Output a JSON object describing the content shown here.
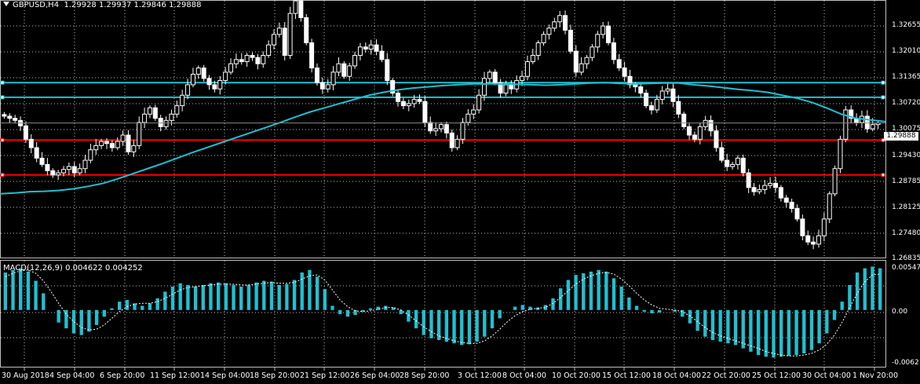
{
  "chart_header": {
    "symbol_timeframe": "GBPUSD,H4",
    "open": "1.29928",
    "high": "1.29937",
    "low": "1.29846",
    "close": "1.29888"
  },
  "price_axis": {
    "labels": [
      "1.32655",
      "1.32010",
      "1.31365",
      "1.30720",
      "1.30075",
      "1.29430",
      "1.28785",
      "1.28125",
      "1.27480",
      "1.26835"
    ],
    "current_price": "1.29888"
  },
  "macd_panel": {
    "title": "MACD(12,26,9) 0.004622 0.004252",
    "axis_labels": [
      "0.005478",
      "0.00",
      "-0.006217"
    ]
  },
  "time_axis": {
    "labels": [
      "30 Aug 2018",
      "4 Sep 04:00",
      "6 Sep 20:00",
      "11 Sep 12:00",
      "14 Sep 04:00",
      "18 Sep 20:00",
      "21 Sep 12:00",
      "26 Sep 04:00",
      "28 Sep 20:00",
      "3 Oct 12:00",
      "8 Oct 04:00",
      "10 Oct 20:00",
      "15 Oct 12:00",
      "18 Oct 04:00",
      "22 Oct 20:00",
      "25 Oct 12:00",
      "30 Oct 04:00",
      "1 Nov 20:00"
    ]
  },
  "colors": {
    "background": "#000000",
    "grid": "#c0c0c0",
    "candles": "#ffffff",
    "moving_average": "#20c0d0",
    "horizontal_lines_cyan": "#20c0d0",
    "horizontal_lines_red": "#ff0000",
    "macd_histogram": "#20c0d0",
    "macd_signal": "#ffffff"
  },
  "chart_data": {
    "type": "candlestick",
    "symbol": "GBPUSD",
    "timeframe": "H4",
    "ylim": [
      1.2668,
      1.3282
    ],
    "close_path": [
      1.3005,
      1.3,
      1.2995,
      1.2982,
      1.295,
      1.293,
      1.2905,
      1.289,
      1.2875,
      1.2865,
      1.287,
      1.2878,
      1.2885,
      1.287,
      1.288,
      1.29,
      1.2925,
      1.2935,
      1.2945,
      1.294,
      1.293,
      1.2945,
      1.296,
      1.292,
      1.2935,
      1.299,
      1.301,
      1.3025,
      1.3,
      1.298,
      1.2995,
      1.301,
      1.303,
      1.3055,
      1.308,
      1.3105,
      1.312,
      1.3095,
      1.308,
      1.307,
      1.309,
      1.311,
      1.313,
      1.314,
      1.3135,
      1.315,
      1.3145,
      1.313,
      1.315,
      1.3175,
      1.32,
      1.3215,
      1.315,
      1.325,
      1.328,
      1.324,
      1.318,
      1.312,
      1.3085,
      1.307,
      1.308,
      1.311,
      1.313,
      1.31,
      1.3125,
      1.315,
      1.317,
      1.3165,
      1.3175,
      1.316,
      1.314,
      1.309,
      1.306,
      1.304,
      1.303,
      1.3035,
      1.3045,
      1.304,
      1.299,
      1.297,
      1.2975,
      1.2985,
      1.2965,
      1.293,
      1.295,
      1.299,
      1.301,
      1.302,
      1.3055,
      1.3095,
      1.311,
      1.3085,
      1.306,
      1.308,
      1.307,
      1.309,
      1.31,
      1.3135,
      1.315,
      1.318,
      1.32,
      1.3215,
      1.323,
      1.3245,
      1.321,
      1.316,
      1.311,
      1.313,
      1.3145,
      1.317,
      1.32,
      1.322,
      1.318,
      1.314,
      1.312,
      1.31,
      1.308,
      1.3075,
      1.306,
      1.303,
      1.302,
      1.3045,
      1.3065,
      1.307,
      1.304,
      1.301,
      1.298,
      1.296,
      1.295,
      1.298,
      1.2995,
      1.297,
      1.293,
      1.29,
      1.2885,
      1.289,
      1.2905,
      1.287,
      1.2835,
      1.2825,
      1.283,
      1.284,
      1.2845,
      1.2835,
      1.281,
      1.28,
      1.2785,
      1.276,
      1.272,
      1.2705,
      1.27,
      1.272,
      1.276,
      1.282,
      1.288,
      1.295,
      1.302,
      1.3,
      1.299,
      1.3005,
      1.2975,
      1.2985,
      1.2989
    ],
    "moving_average_path": [
      1.282,
      1.2822,
      1.2825,
      1.2826,
      1.2828,
      1.2832,
      1.2838,
      1.2845,
      1.2856,
      1.2868,
      1.288,
      1.2892,
      1.2905,
      1.2918,
      1.293,
      1.2942,
      1.2954,
      1.2966,
      1.2978,
      1.299,
      1.3003,
      1.3015,
      1.3025,
      1.3035,
      1.3045,
      1.3055,
      1.3062,
      1.3068,
      1.3072,
      1.3075,
      1.3078,
      1.308,
      1.3082,
      1.3082,
      1.3082,
      1.3081,
      1.308,
      1.3079,
      1.308,
      1.3082,
      1.3084,
      1.3085,
      1.3083,
      1.3082,
      1.3083,
      1.3084,
      1.3084,
      1.308,
      1.3077,
      1.3073,
      1.3069,
      1.3066,
      1.3062,
      1.3055,
      1.3048,
      1.3038,
      1.3025,
      1.301,
      1.3,
      1.2996,
      1.2992
    ],
    "horizontal_lines": [
      {
        "price": 1.3085,
        "color": "#20c0d0"
      },
      {
        "price": 1.305,
        "color": "#20c0d0"
      },
      {
        "price": 1.2948,
        "color": "#ff0000"
      },
      {
        "price": 1.2865,
        "color": "#ff0000"
      }
    ],
    "macd": {
      "ylim": [
        -0.0068,
        0.006
      ],
      "main_value": 0.004622,
      "signal_value": 0.004252,
      "histogram": [
        0.0045,
        0.0048,
        0.005,
        0.0046,
        0.0035,
        0.002,
        0.0,
        -0.0015,
        -0.0022,
        -0.0028,
        -0.003,
        -0.0026,
        -0.0018,
        -0.0008,
        0.0002,
        0.001,
        0.0012,
        0.0008,
        0.0005,
        0.0008,
        0.0014,
        0.0022,
        0.0028,
        0.0032,
        0.003,
        0.0028,
        0.003,
        0.0032,
        0.0033,
        0.0032,
        0.003,
        0.0028,
        0.003,
        0.0033,
        0.0035,
        0.0034,
        0.003,
        0.0031,
        0.0036,
        0.0045,
        0.0048,
        0.004,
        0.0025,
        0.0005,
        -0.0005,
        -0.0008,
        -0.0006,
        -0.0002,
        0.0002,
        0.0004,
        0.0005,
        0.0003,
        -0.0005,
        -0.0014,
        -0.0022,
        -0.003,
        -0.0034,
        -0.0036,
        -0.0038,
        -0.004,
        -0.0042,
        -0.0041,
        -0.0038,
        -0.0032,
        -0.0022,
        -0.001,
        0.0,
        0.0004,
        0.0006,
        0.0004,
        0.0003,
        0.0006,
        0.0014,
        0.0026,
        0.0036,
        0.0042,
        0.0044,
        0.0046,
        0.0048,
        0.0046,
        0.0038,
        0.0028,
        0.0015,
        0.0005,
        -0.0002,
        -0.0004,
        -0.0003,
        0.0,
        -0.0002,
        -0.0008,
        -0.0016,
        -0.0025,
        -0.0032,
        -0.0036,
        -0.0038,
        -0.004,
        -0.0042,
        -0.0046,
        -0.005,
        -0.0054,
        -0.0056,
        -0.0057,
        -0.0056,
        -0.0055,
        -0.0054,
        -0.0052,
        -0.0048,
        -0.004,
        -0.0028,
        -0.0012,
        0.001,
        0.003,
        0.0045,
        0.005,
        0.0052,
        0.005
      ],
      "signal": [
        0.004,
        0.0044,
        0.0047,
        0.0048,
        0.0044,
        0.0035,
        0.0022,
        0.0008,
        -0.0005,
        -0.0014,
        -0.0021,
        -0.0024,
        -0.0023,
        -0.0018,
        -0.001,
        -0.0002,
        0.0004,
        0.0007,
        0.0008,
        0.0008,
        0.001,
        0.0014,
        0.0019,
        0.0024,
        0.0027,
        0.0028,
        0.0029,
        0.003,
        0.0031,
        0.0031,
        0.0031,
        0.003,
        0.003,
        0.0031,
        0.0032,
        0.0033,
        0.0032,
        0.0032,
        0.0033,
        0.0037,
        0.0041,
        0.0042,
        0.0036,
        0.0024,
        0.0012,
        0.0004,
        -0.0001,
        -0.0002,
        -0.0001,
        0.0001,
        0.0003,
        0.0003,
        0.0,
        -0.0006,
        -0.0013,
        -0.002,
        -0.0026,
        -0.0031,
        -0.0034,
        -0.0037,
        -0.0039,
        -0.004,
        -0.004,
        -0.0037,
        -0.0031,
        -0.0023,
        -0.0014,
        -0.0007,
        -0.0002,
        0.0001,
        0.0002,
        0.0003,
        0.0008,
        0.0015,
        0.0023,
        0.0031,
        0.0037,
        0.0041,
        0.0044,
        0.0045,
        0.0043,
        0.0037,
        0.0029,
        0.002,
        0.0012,
        0.0006,
        0.0002,
        0.0001,
        0.0,
        -0.0002,
        -0.0007,
        -0.0014,
        -0.0021,
        -0.0027,
        -0.0031,
        -0.0034,
        -0.0037,
        -0.004,
        -0.0043,
        -0.0046,
        -0.005,
        -0.0052,
        -0.0054,
        -0.0055,
        -0.0055,
        -0.0054,
        -0.0052,
        -0.0048,
        -0.0041,
        -0.003,
        -0.0015,
        0.0003,
        0.002,
        0.0034,
        0.0042,
        0.0043
      ]
    }
  }
}
